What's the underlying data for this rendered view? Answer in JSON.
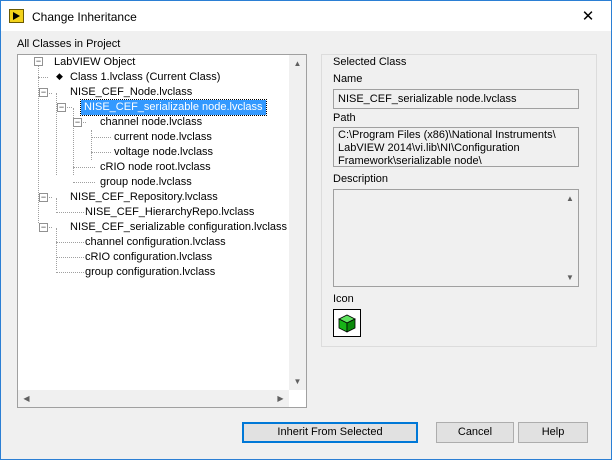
{
  "window": {
    "title": "Change Inheritance",
    "close_glyph": "✕"
  },
  "tree": {
    "label": "All Classes in Project",
    "items": [
      {
        "text": "LabVIEW Object"
      },
      {
        "text": "Class 1.lvclass (Current Class)"
      },
      {
        "text": "NISE_CEF_Node.lvclass"
      },
      {
        "text": "NISE_CEF_serializable node.lvclass"
      },
      {
        "text": "channel node.lvclass"
      },
      {
        "text": "current node.lvclass"
      },
      {
        "text": "voltage node.lvclass"
      },
      {
        "text": "cRIO  node root.lvclass"
      },
      {
        "text": "group node.lvclass"
      },
      {
        "text": "NISE_CEF_Repository.lvclass"
      },
      {
        "text": "NISE_CEF_HierarchyRepo.lvclass"
      },
      {
        "text": "NISE_CEF_serializable configuration.lvclass"
      },
      {
        "text": "channel configuration.lvclass"
      },
      {
        "text": "cRIO configuration.lvclass"
      },
      {
        "text": "group configuration.lvclass"
      }
    ],
    "expander_glyph": "−"
  },
  "selected": {
    "group_label": "Selected Class",
    "name_label": "Name",
    "name_value": "NISE_CEF_serializable node.lvclass",
    "path_label": "Path",
    "path_lines": [
      "C:\\Program Files (x86)\\National Instruments\\",
      "LabVIEW 2014\\vi.lib\\NI\\Configuration",
      "Framework\\serializable node\\"
    ],
    "description_label": "Description",
    "icon_label": "Icon",
    "class_icon": "green-cube-icon"
  },
  "buttons": {
    "inherit": "Inherit From Selected",
    "cancel": "Cancel",
    "help": "Help"
  },
  "colors": {
    "selection": "#3399ff",
    "default_button_border": "#0078d7",
    "cube": "#17b317"
  }
}
